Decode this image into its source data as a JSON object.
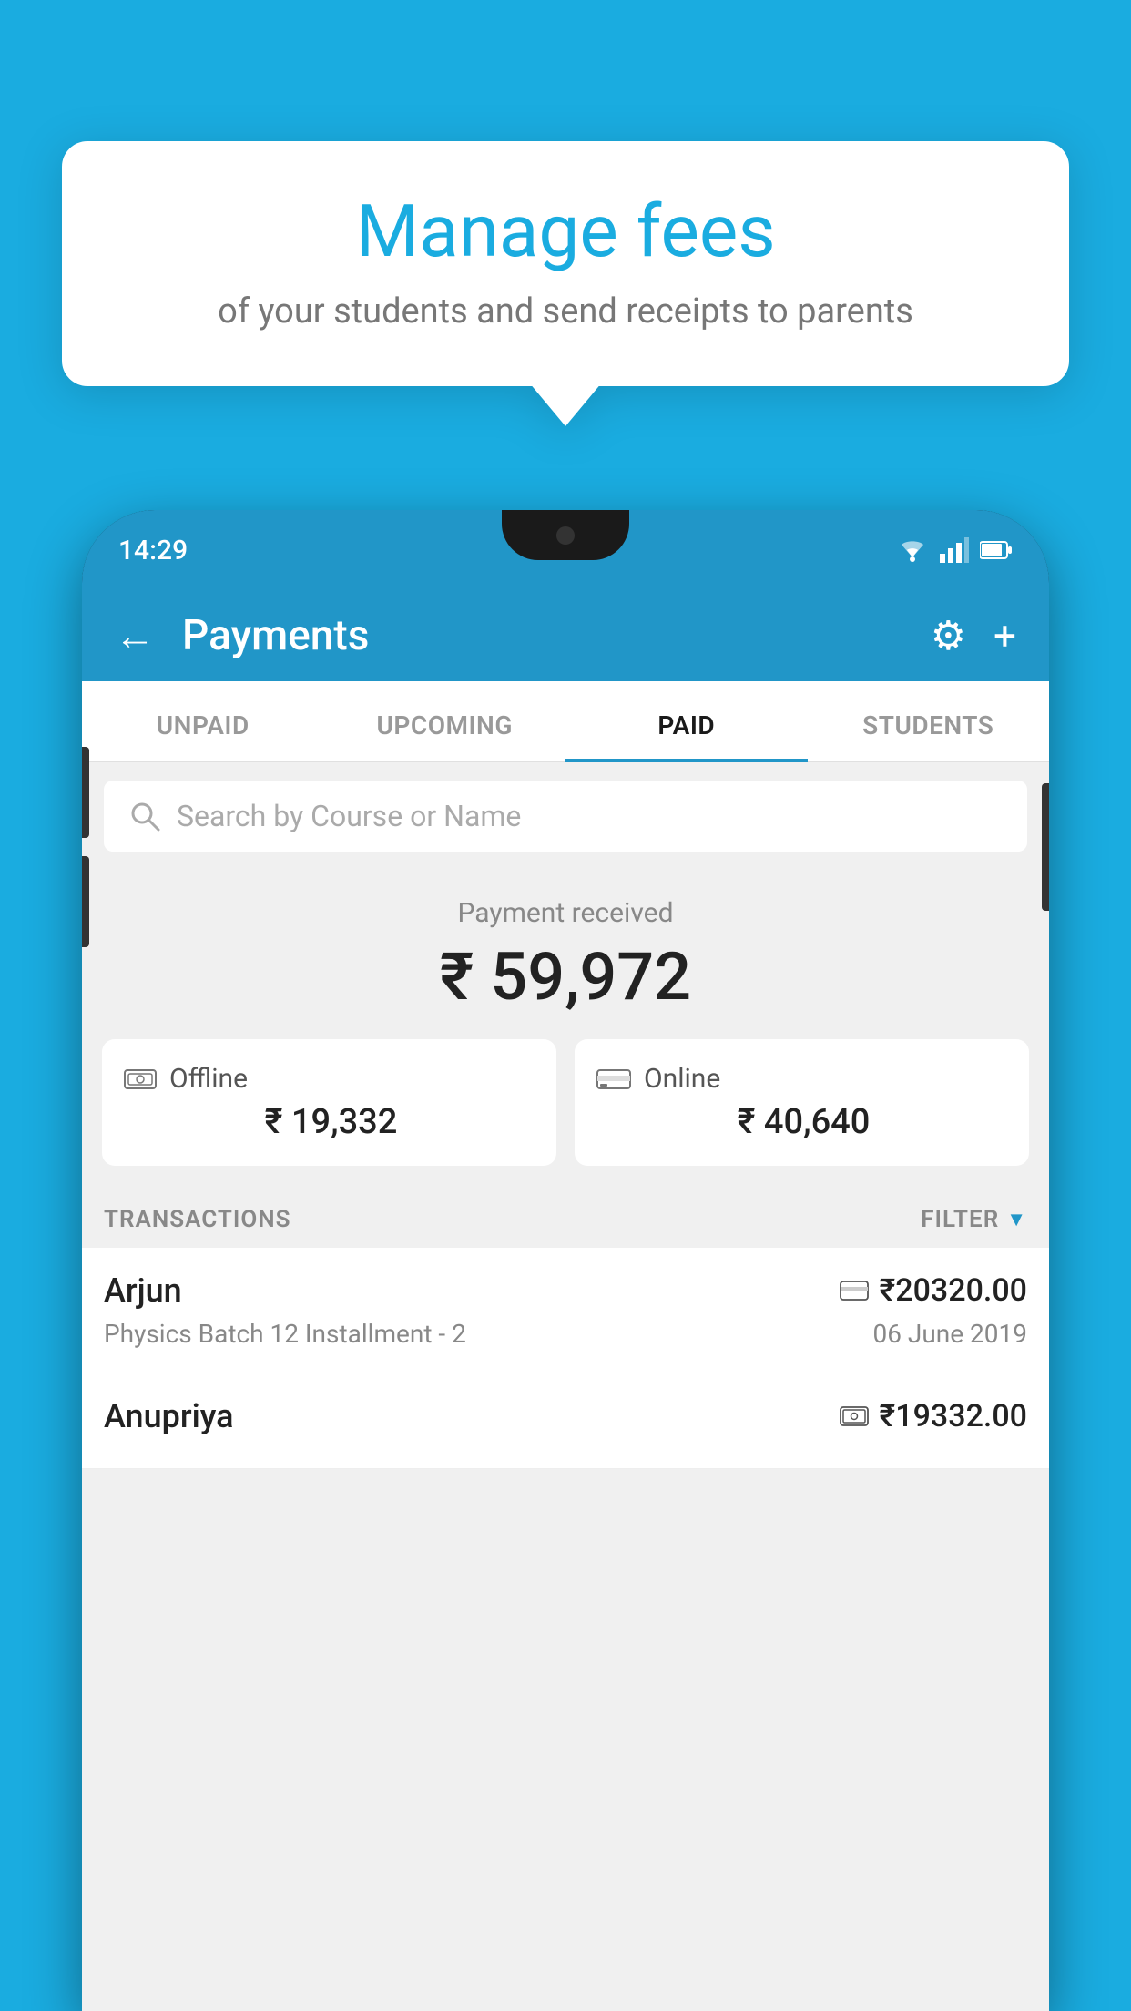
{
  "background": {
    "color": "#1AACE0"
  },
  "speech_bubble": {
    "title": "Manage fees",
    "subtitle": "of your students and send receipts to parents"
  },
  "status_bar": {
    "time": "14:29",
    "wifi": "▼",
    "signal": "▲",
    "battery": "▐"
  },
  "app_header": {
    "back_label": "←",
    "title": "Payments",
    "gear_icon": "⚙",
    "plus_icon": "+"
  },
  "tabs": [
    {
      "label": "UNPAID",
      "active": false
    },
    {
      "label": "UPCOMING",
      "active": false
    },
    {
      "label": "PAID",
      "active": true
    },
    {
      "label": "STUDENTS",
      "active": false
    }
  ],
  "search": {
    "placeholder": "Search by Course or Name"
  },
  "payment_summary": {
    "received_label": "Payment received",
    "total_amount": "₹ 59,972",
    "offline_label": "Offline",
    "offline_amount": "₹ 19,332",
    "online_label": "Online",
    "online_amount": "₹ 40,640"
  },
  "transactions_section": {
    "label": "TRANSACTIONS",
    "filter_label": "FILTER"
  },
  "transactions": [
    {
      "name": "Arjun",
      "amount": "₹20320.00",
      "detail": "Physics Batch 12 Installment - 2",
      "date": "06 June 2019",
      "type": "online"
    },
    {
      "name": "Anupriya",
      "amount": "₹19332.00",
      "detail": "",
      "date": "",
      "type": "offline"
    }
  ]
}
